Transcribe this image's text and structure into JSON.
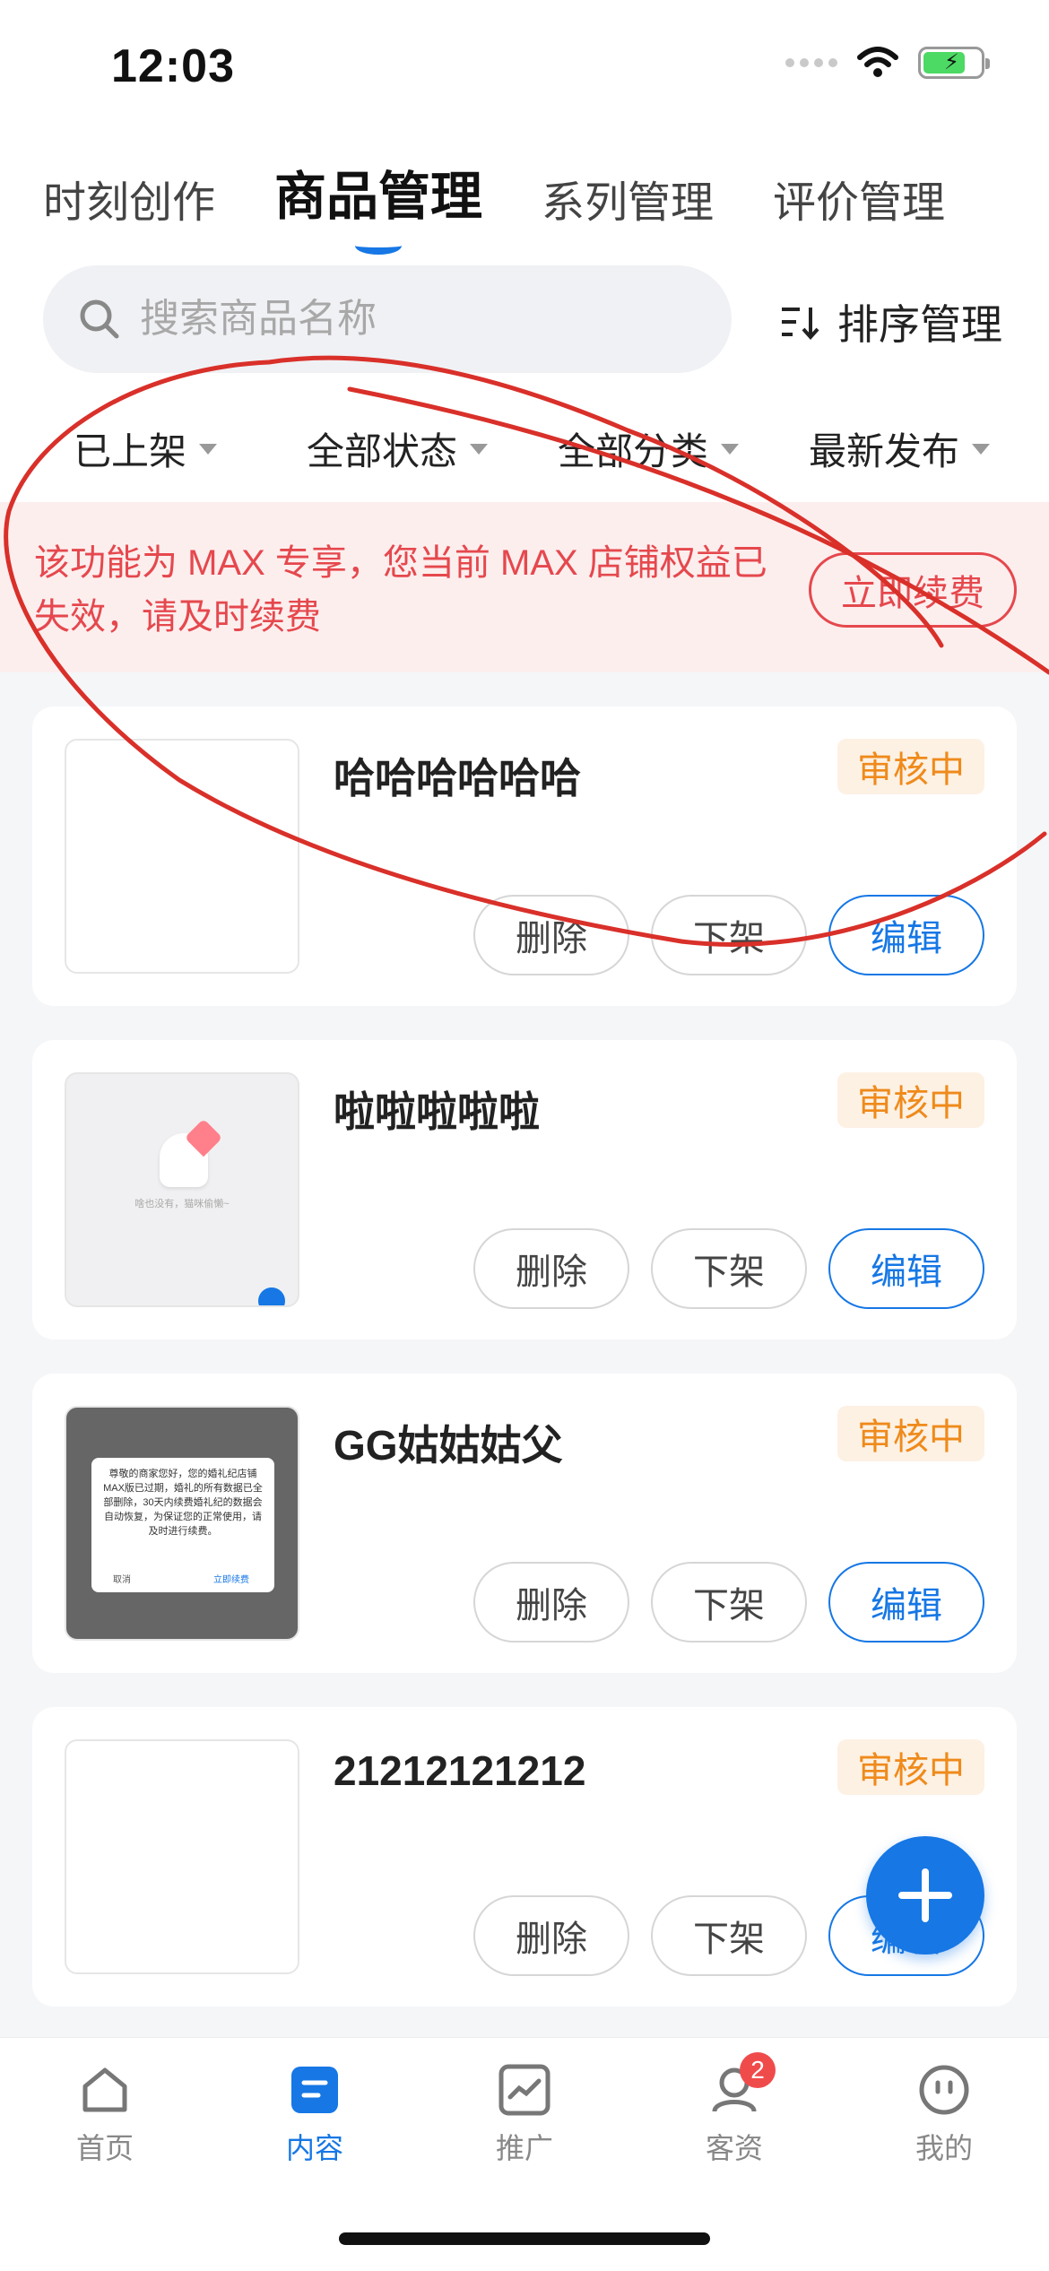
{
  "status_bar": {
    "time": "12:03"
  },
  "tabs": [
    {
      "label": "时刻创作"
    },
    {
      "label": "商品管理"
    },
    {
      "label": "系列管理"
    },
    {
      "label": "评价管理"
    }
  ],
  "search": {
    "placeholder": "搜索商品名称"
  },
  "sort": {
    "label": "排序管理",
    "icon": "sort-icon"
  },
  "filters": [
    {
      "label": "已上架"
    },
    {
      "label": "全部状态"
    },
    {
      "label": "全部分类"
    },
    {
      "label": "最新发布"
    }
  ],
  "banner": {
    "message": "该功能为 MAX 专享，您当前 MAX 店铺权益已失效，请及时续费",
    "button": "立即续费"
  },
  "products": [
    {
      "name": "哈哈哈哈哈哈",
      "status": "审核中",
      "delete": "删除",
      "unlist": "下架",
      "edit": "编辑"
    },
    {
      "name": "啦啦啦啦啦",
      "status": "审核中",
      "delete": "删除",
      "unlist": "下架",
      "edit": "编辑"
    },
    {
      "name": "GG姑姑姑父",
      "status": "审核中",
      "delete": "删除",
      "unlist": "下架",
      "edit": "编辑"
    },
    {
      "name": "21212121212",
      "status": "审核中",
      "delete": "删除",
      "unlist": "下架",
      "edit": "编辑"
    }
  ],
  "thumb2": {
    "caption": "啥也没有，猫咪偷懒~"
  },
  "thumb3": {
    "dialog_text": "尊敬的商家您好，您的婚礼纪店铺MAX版已过期，婚礼的所有数据已全部删除，30天内续费婚礼纪的数据会自动恢复，为保证您的正常使用，请及时进行续费。",
    "cancel": "取消",
    "confirm": "立即续费"
  },
  "bottom_nav": [
    {
      "label": "首页",
      "icon": "home-icon"
    },
    {
      "label": "内容",
      "icon": "content-icon"
    },
    {
      "label": "推广",
      "icon": "promotion-icon"
    },
    {
      "label": "客资",
      "icon": "customer-icon",
      "badge": "2"
    },
    {
      "label": "我的",
      "icon": "profile-icon"
    }
  ],
  "colors": {
    "accent": "#1677e5",
    "warning": "#e5484d",
    "status_orange": "#ef8a1b",
    "annotation": "#d9302a"
  }
}
